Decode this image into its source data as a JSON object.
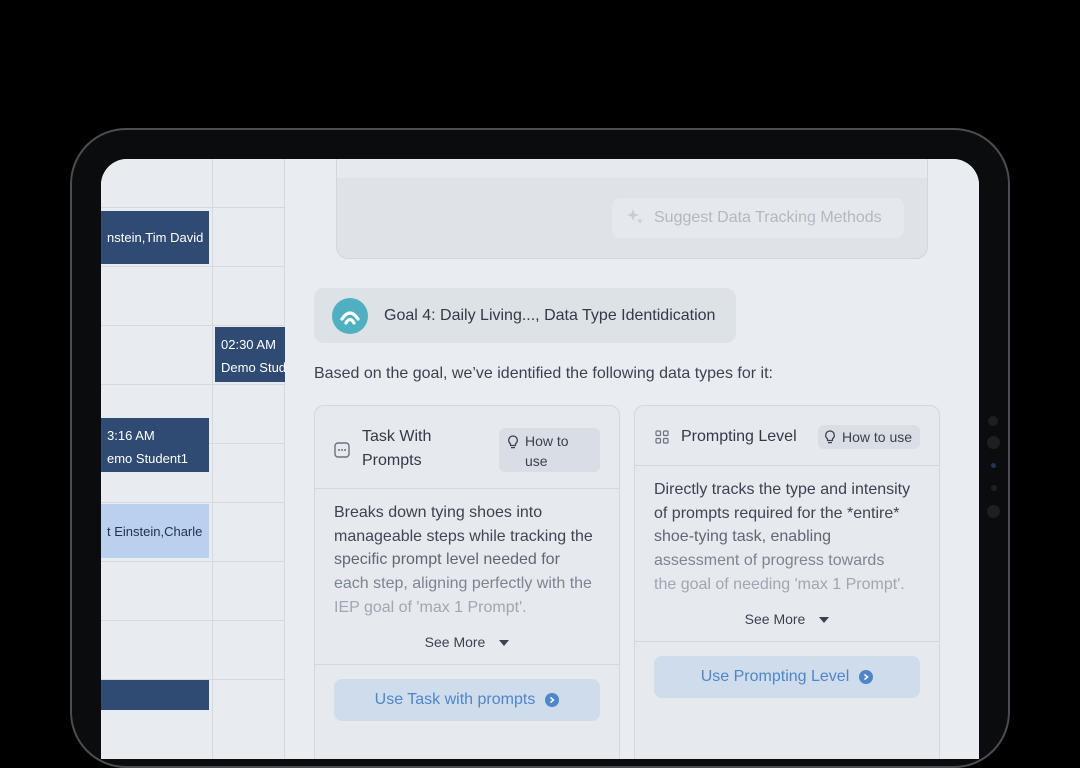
{
  "calendar": {
    "events": [
      {
        "time": "",
        "name": "nstein,Tim David"
      },
      {
        "time": "02:30 AM",
        "name": "Demo Stud"
      },
      {
        "time": "3:16 AM",
        "name": "emo Student1"
      },
      {
        "time": "",
        "name": "t Einstein,Charle"
      }
    ]
  },
  "panel": {
    "suggest_button": "Suggest Data Tracking Methods",
    "goal_title": "Goal 4: Daily Living..., Data Type Identidication",
    "intro": "Based on the goal, we’ve identified the following data types for it:",
    "cards": [
      {
        "title_line1": "Task With",
        "title_line2": "Prompts",
        "how_to_line1": "How to",
        "how_to_line2": "use",
        "body_lines": [
          "Breaks down tying shoes into",
          "manageable steps while tracking the",
          "specific prompt level needed for",
          "each step, aligning perfectly with the",
          "IEP goal of 'max 1 Prompt'."
        ],
        "see_more": "See More",
        "use_button": "Use Task with prompts"
      },
      {
        "title": "Prompting Level",
        "how_to": "How to use",
        "body_lines": [
          "Directly tracks the type and intensity",
          "of prompts required for the *entire*",
          "shoe-tying task, enabling",
          "assessment of progress towards",
          "the goal of needing 'max 1 Prompt'."
        ],
        "see_more": "See More",
        "use_button": "Use Prompting Level"
      }
    ]
  },
  "colors": {
    "event_dark": "#2f4a73",
    "event_light": "#b9d0ee",
    "accent": "#4f86c9",
    "goal_logo": "#4fb0c1"
  },
  "icons": [
    "sparkle-icon",
    "goal-logo-icon",
    "task-list-icon",
    "grid-icon",
    "lightbulb-icon",
    "chevron-down-icon",
    "arrow-right-circle-icon"
  ]
}
